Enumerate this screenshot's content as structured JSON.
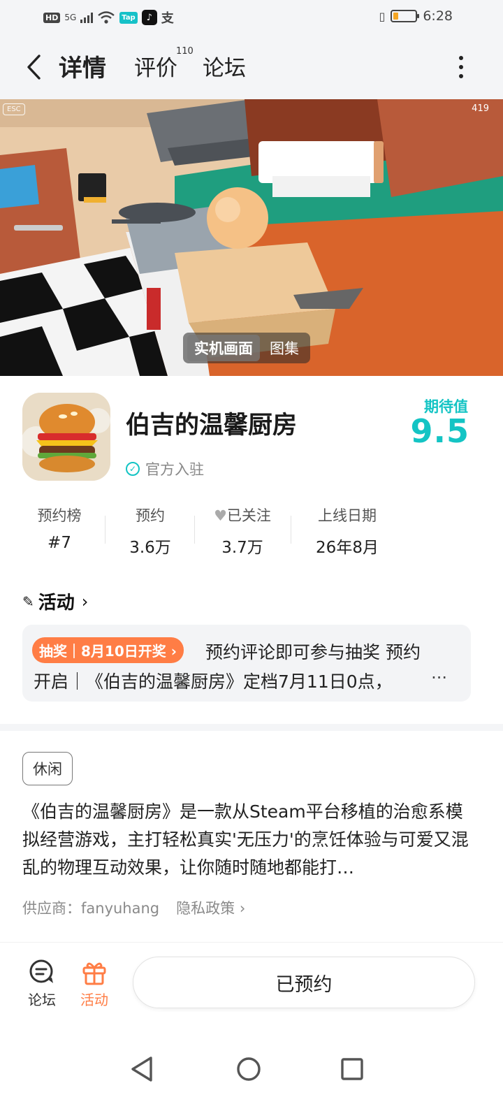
{
  "status_bar": {
    "hd": "HD",
    "network": "5G",
    "tap_label": "Tap",
    "alipay_glyph": "支",
    "time": "6:28",
    "battery_level": 0.22
  },
  "nav": {
    "tabs": [
      {
        "label": "详情",
        "active": true
      },
      {
        "label": "评价",
        "badge": "110"
      },
      {
        "label": "论坛"
      }
    ]
  },
  "media": {
    "esc": "ESC",
    "coin_count": "419",
    "switch": [
      "实机画面",
      "图集"
    ]
  },
  "game": {
    "title": "伯吉的温馨厨房",
    "official": "官方入驻",
    "expect_label": "期待值",
    "expect_score": "9.5"
  },
  "stats": [
    {
      "label": "预约榜",
      "value": "#7"
    },
    {
      "label": "预约",
      "value": "3.6万"
    },
    {
      "label": "已关注",
      "value": "3.7万"
    },
    {
      "label": "上线日期",
      "value": "26年8月"
    }
  ],
  "activity": {
    "heading": "活动",
    "badge": "抽奖｜8月10日开奖",
    "line1": "预约评论即可参与抽奖 预约",
    "line2": "开启｜《伯吉的温馨厨房》定档7月11日0点，",
    "more": "···"
  },
  "info": {
    "tag": "休闲",
    "description": "《伯吉的温馨厨房》是一款从Steam平台移植的治愈系模拟经营游戏，主打轻松真实'无压力'的烹饪体验与可爱又混乱的物理互动效果，让你随时随地都能打…",
    "supplier": "供应商：fanyuhang",
    "privacy": "隐私政策"
  },
  "bottom": {
    "forum": "论坛",
    "activity": "活动",
    "reserved": "已预约"
  },
  "colors": {
    "accent": "#14c4c4",
    "orange": "#ff7d45"
  }
}
